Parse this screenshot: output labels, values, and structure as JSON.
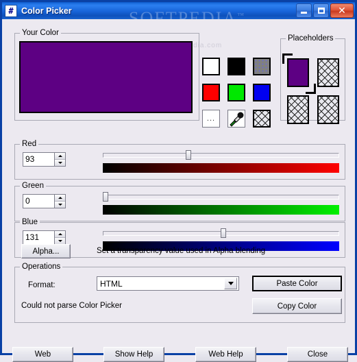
{
  "window": {
    "title": "Color Picker",
    "icon": "#",
    "buttons": {
      "minimize": "minimize",
      "maximize": "maximize",
      "close": "close"
    }
  },
  "watermark": {
    "brand": "SOFTPEDIA",
    "tm": "™",
    "url": "www.softpedia.com"
  },
  "your_color": {
    "group_label": "Your Color",
    "color_hex": "#5D0083"
  },
  "swatches": {
    "items": [
      {
        "name": "white",
        "color": "#FFFFFF",
        "kind": "solid"
      },
      {
        "name": "black",
        "color": "#000000",
        "kind": "solid"
      },
      {
        "name": "gray-dither",
        "color": "#808080",
        "kind": "dither"
      },
      {
        "name": "red",
        "color": "#FF0000",
        "kind": "solid"
      },
      {
        "name": "green",
        "color": "#00E800",
        "kind": "solid"
      },
      {
        "name": "blue",
        "color": "#0000F0",
        "kind": "solid"
      },
      {
        "name": "more",
        "color": "#FFFFFF",
        "kind": "ellipsis",
        "label": "..."
      },
      {
        "name": "eyedropper",
        "color": "#FFFFFF",
        "kind": "eyedropper"
      },
      {
        "name": "transparent",
        "color": "#E8E8EE",
        "kind": "checker"
      }
    ]
  },
  "placeholders": {
    "group_label": "Placeholders",
    "slots": [
      {
        "name": "slot-1",
        "color": "#5D0083",
        "empty": false,
        "selected": true
      },
      {
        "name": "slot-2",
        "color": "",
        "empty": true,
        "selected": false
      },
      {
        "name": "slot-3",
        "color": "",
        "empty": true,
        "selected": false
      },
      {
        "name": "slot-4",
        "color": "",
        "empty": true,
        "selected": false
      }
    ]
  },
  "channels": [
    {
      "name": "red",
      "label": "Red",
      "value": "93",
      "percent": 36,
      "gradient_from": "#000000",
      "gradient_to": "#FF0000"
    },
    {
      "name": "green",
      "label": "Green",
      "value": "0",
      "percent": 0,
      "gradient_from": "#000000",
      "gradient_to": "#00F000"
    },
    {
      "name": "blue",
      "label": "Blue",
      "value": "131",
      "percent": 51,
      "gradient_from": "#000000",
      "gradient_to": "#0000FF"
    }
  ],
  "alpha": {
    "button_label": "Alpha...",
    "description": "Set a transparency value used in Alpha blending"
  },
  "operations": {
    "group_label": "Operations",
    "format_label": "Format:",
    "format_value": "HTML",
    "status": "Could not parse Color Picker",
    "paste_label": "Paste Color",
    "copy_label": "Copy Color"
  },
  "footer": {
    "web": "Web",
    "show_help": "Show Help",
    "web_help": "Web Help",
    "close": "Close"
  }
}
